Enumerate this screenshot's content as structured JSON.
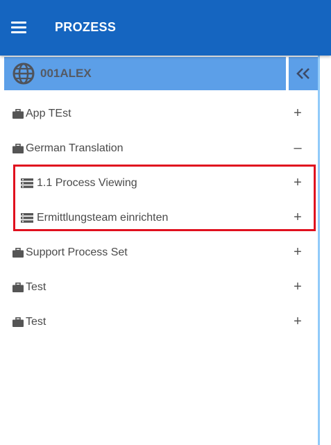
{
  "header": {
    "title": "PROZESS",
    "menu_icon": "hamburger-menu-icon"
  },
  "sidebar": {
    "account": "001ALEX",
    "account_icon": "globe-icon",
    "collapse_icon": "double-chevron-left-icon",
    "items": [
      {
        "label": "App TEst",
        "icon": "briefcase-icon",
        "toggle": "+",
        "level": 0
      },
      {
        "label": "German Translation",
        "icon": "briefcase-icon",
        "toggle": "–",
        "level": 0
      },
      {
        "label": "1.1 Process Viewing",
        "icon": "process-list-icon",
        "toggle": "+",
        "level": 1
      },
      {
        "label": "Ermittlungsteam einrichten",
        "icon": "process-list-icon",
        "toggle": "+",
        "level": 1
      },
      {
        "label": "Support Process Set",
        "icon": "briefcase-icon",
        "toggle": "+",
        "level": 0
      },
      {
        "label": "Test",
        "icon": "briefcase-icon",
        "toggle": "+",
        "level": 0
      },
      {
        "label": "Test",
        "icon": "briefcase-icon",
        "toggle": "+",
        "level": 0
      }
    ]
  },
  "colors": {
    "appbar": "#1565c0",
    "panel_header": "#5c9fe8",
    "highlight_border": "#e0101e",
    "text": "#4a4a4a"
  }
}
